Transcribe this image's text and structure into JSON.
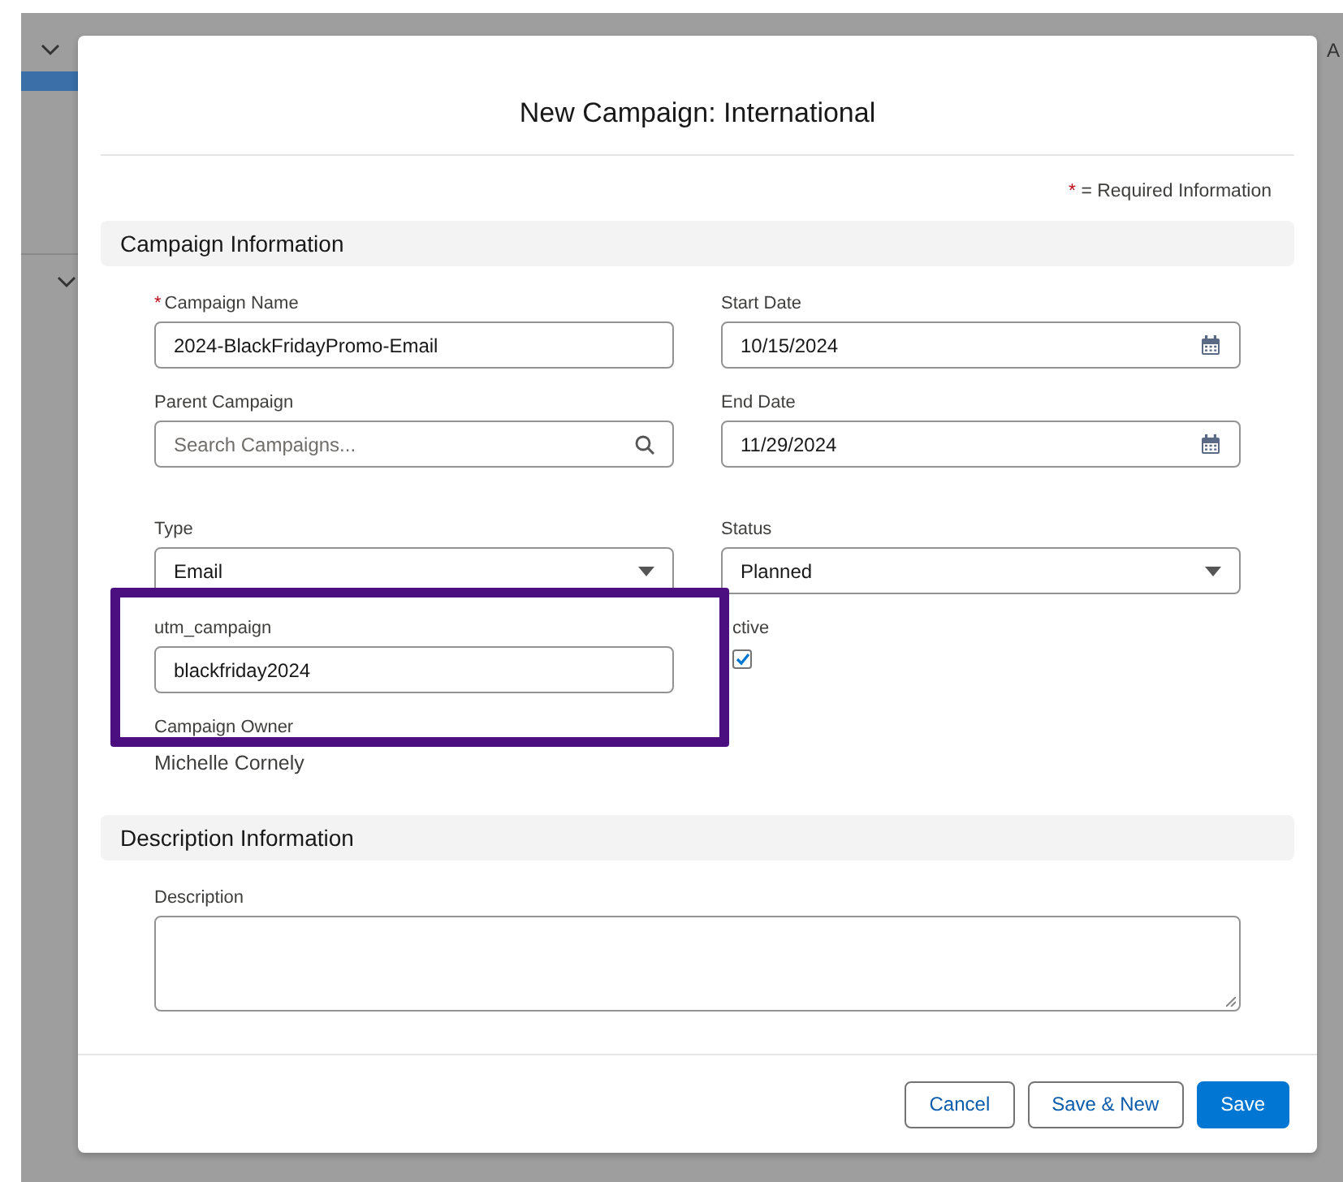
{
  "backdrop": {
    "right_text": "A"
  },
  "modal": {
    "title": "New Campaign: International",
    "required_note": {
      "marker": "*",
      "text": "= Required Information"
    },
    "sections": [
      {
        "title": "Campaign Information",
        "rows": [
          [
            {
              "kind": "text",
              "label": "Campaign Name",
              "required": true,
              "value": "2024-BlackFridayPromo-Email"
            },
            {
              "kind": "date",
              "label": "Start Date",
              "required": false,
              "value": "10/15/2024"
            }
          ],
          [
            {
              "kind": "lookup",
              "label": "Parent Campaign",
              "required": false,
              "placeholder": "Search Campaigns..."
            },
            {
              "kind": "date",
              "label": "End Date",
              "required": false,
              "value": "11/29/2024"
            }
          ],
          [
            {
              "kind": "select",
              "label": "Type",
              "required": false,
              "value": "Email"
            },
            {
              "kind": "select",
              "label": "Status",
              "required": false,
              "value": "Planned"
            }
          ],
          [
            {
              "kind": "text",
              "label": "utm_campaign",
              "required": false,
              "value": "blackfriday2024",
              "highlighted": true
            },
            {
              "kind": "checkbox",
              "label": "ctive",
              "required": false,
              "checked": true
            }
          ],
          [
            {
              "kind": "readonly",
              "label": "Campaign Owner",
              "required": false,
              "value": "Michelle Cornely"
            }
          ]
        ]
      },
      {
        "title": "Description Information",
        "rows": [
          [
            {
              "kind": "textarea",
              "label": "Description",
              "required": false
            }
          ]
        ]
      }
    ],
    "buttons": [
      {
        "label": "Cancel",
        "kind": "neutral"
      },
      {
        "label": "Save & New",
        "kind": "neutral"
      },
      {
        "label": "Save",
        "kind": "brand"
      }
    ]
  },
  "highlight": {
    "color": "#4b0f7f"
  }
}
